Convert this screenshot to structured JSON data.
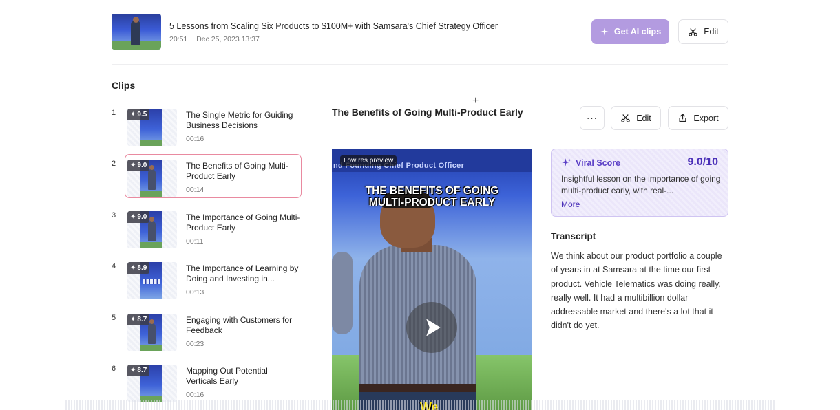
{
  "header": {
    "title": "5 Lessons from Scaling Six Products to $100M+ with Samsara's Chief Strategy Officer",
    "duration": "20:51",
    "date": "Dec 25, 2023 13:37",
    "get_ai_clips_label": "Get AI clips",
    "edit_label": "Edit"
  },
  "clips": {
    "heading": "Clips",
    "items": [
      {
        "num": "1",
        "score": "9.5",
        "title": "The Single Metric for Guiding Business Decisions",
        "duration": "00:16"
      },
      {
        "num": "2",
        "score": "9.0",
        "title": "The Benefits of Going Multi-Product Early",
        "duration": "00:14"
      },
      {
        "num": "3",
        "score": "9.0",
        "title": "The Importance of Going Multi-Product Early",
        "duration": "00:11"
      },
      {
        "num": "4",
        "score": "8.9",
        "title": "The Importance of Learning by Doing and Investing in...",
        "duration": "00:13"
      },
      {
        "num": "5",
        "score": "8.7",
        "title": "Engaging with Customers for Feedback",
        "duration": "00:23"
      },
      {
        "num": "6",
        "score": "8.7",
        "title": "Mapping Out Potential Verticals Early",
        "duration": "00:16"
      }
    ]
  },
  "detail": {
    "title": "The Benefits of Going Multi-Product Early",
    "more_label": "···",
    "edit_label": "Edit",
    "export_label": "Export"
  },
  "video": {
    "banner_text": "nd Founding Chief Product Officer",
    "lowres_label": "Low res preview",
    "caption_line1": "THE BENEFITS OF GOING",
    "caption_line2": "MULTI-PRODUCT EARLY",
    "subtitle_word": "We"
  },
  "viral": {
    "label": "Viral Score",
    "value": "9.0/10",
    "description": "Insightful lesson on the importance of going multi-product early, with real-...",
    "more_label": "More",
    "accent_color": "#5b3fc6"
  },
  "transcript": {
    "heading": "Transcript",
    "text": "We think about our product portfolio a couple of years in at Samsara at the time our first product. Vehicle Telematics was doing really, really well. It had a multibillion dollar addressable market and there's a lot that it didn't do yet."
  }
}
